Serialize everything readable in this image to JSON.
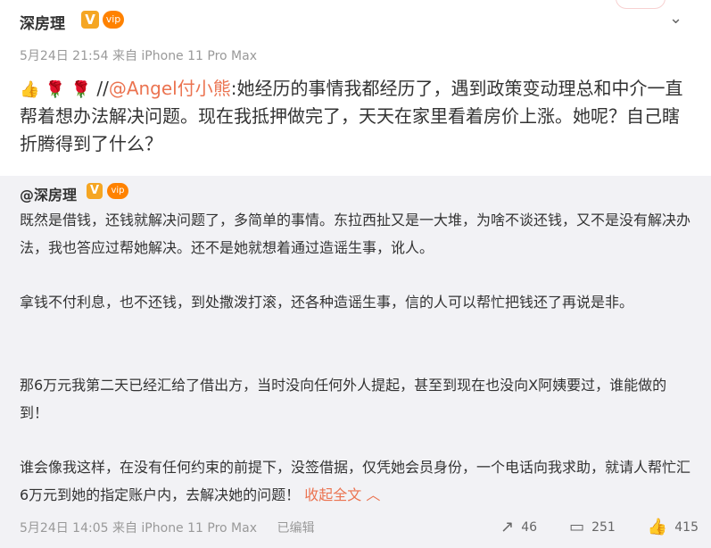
{
  "post": {
    "author": "深房理",
    "v_badge": "V",
    "vip_badge": "vip",
    "meta": "5月24日 21:54 来自 iPhone 11 Pro Max",
    "emoji_like": "👍",
    "emoji_flower": "🌹",
    "prefix": "//",
    "mention": "@Angel付小熊",
    "text": ":她经历的事情我都经历了，遇到政策变动理总和中介一直帮着想办法解决问题。现在我抵押做完了，天天在家里看着房价上涨。她呢？自己瞎折腾得到了什么？"
  },
  "repost": {
    "author": "@深房理",
    "v_badge": "V",
    "vip_badge": "vip",
    "p1": "既然是借钱，还钱就解决问题了，多简单的事情。东拉西扯又是一大堆，为啥不谈还钱，又不是没有解决办法，我也答应过帮她解决。还不是她就想着通过造谣生事，讹人。",
    "p2": "拿钱不付利息，也不还钱，到处撒泼打滚，还各种造谣生事，信的人可以帮忙把钱还了再说是非。",
    "p3": "那6万元我第二天已经汇给了借出方，当时没向任何外人提起，甚至到现在也没向X阿姨要过，谁能做的到！",
    "p4": "谁会像我这样，在没有任何约束的前提下，没签借据，仅凭她会员身份，一个电话向我求助，就请人帮忙汇6万元到她的指定账户内，去解决她的问题！",
    "collapse": "收起全文 ︿",
    "meta": "5月24日 14:05 来自 iPhone 11 Pro Max",
    "edited": "已编辑",
    "repost_count": "46",
    "comment_count": "251",
    "like_count": "415"
  },
  "icons": {
    "chevron": "chevron-down-icon",
    "repost": "repost-icon",
    "comment": "comment-icon",
    "like": "like-icon"
  }
}
